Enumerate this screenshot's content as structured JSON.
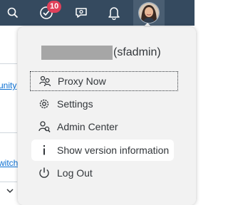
{
  "shellbar": {
    "notifications_count": "10",
    "icons": [
      "search-icon",
      "notifications-icon",
      "feedback-icon",
      "bell-icon"
    ],
    "background_color": "#354a5f"
  },
  "background_page": {
    "link_1": "unity",
    "link_2": "witch"
  },
  "user_menu": {
    "username": "(sfadmin)",
    "items": [
      {
        "label": "Proxy Now",
        "icon": "proxy-icon"
      },
      {
        "label": "Settings",
        "icon": "gear-icon"
      },
      {
        "label": "Admin Center",
        "icon": "admin-center-icon"
      },
      {
        "label": "Show version information",
        "icon": "info-icon"
      },
      {
        "label": "Log Out",
        "icon": "power-icon"
      }
    ]
  }
}
